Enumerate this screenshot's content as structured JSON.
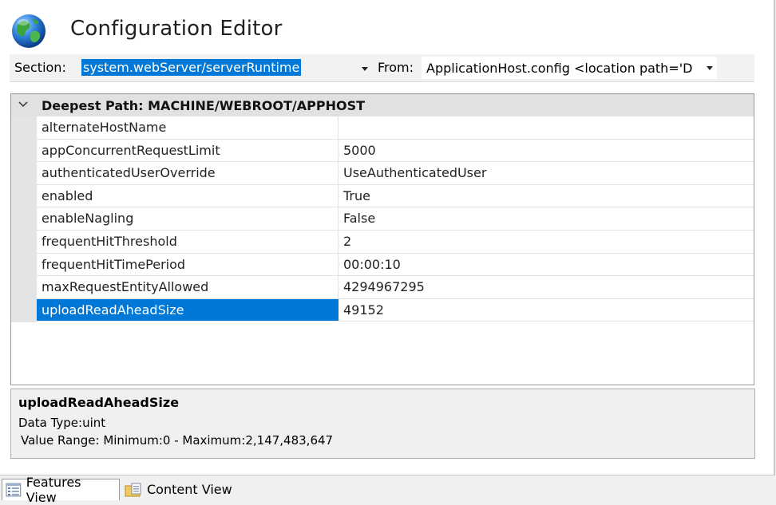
{
  "header": {
    "title": "Configuration Editor",
    "icon": "globe-icon"
  },
  "section_bar": {
    "section_label": "Section:",
    "section_value": "system.webServer/serverRuntime",
    "from_label": "From:",
    "from_value": "ApplicationHost.config <location path='D"
  },
  "grid": {
    "header": "Deepest Path: MACHINE/WEBROOT/APPHOST",
    "rows": [
      {
        "name": "alternateHostName",
        "value": ""
      },
      {
        "name": "appConcurrentRequestLimit",
        "value": "5000"
      },
      {
        "name": "authenticatedUserOverride",
        "value": "UseAuthenticatedUser"
      },
      {
        "name": "enabled",
        "value": "True"
      },
      {
        "name": "enableNagling",
        "value": "False"
      },
      {
        "name": "frequentHitThreshold",
        "value": "2"
      },
      {
        "name": "frequentHitTimePeriod",
        "value": "00:00:10"
      },
      {
        "name": "maxRequestEntityAllowed",
        "value": "4294967295"
      },
      {
        "name": "uploadReadAheadSize",
        "value": "49152"
      }
    ],
    "selected_row": "uploadReadAheadSize"
  },
  "details": {
    "title": "uploadReadAheadSize",
    "data_type": "Data Type:uint",
    "value_range": "Value Range: Minimum:0 - Maximum:2,147,483,647"
  },
  "tabs": [
    {
      "label": "Features View",
      "active": true,
      "icon": "features-view-icon"
    },
    {
      "label": "Content View",
      "active": false,
      "icon": "content-view-icon"
    }
  ],
  "colors": {
    "selection": "#0078d7",
    "grid_header": "#e1e1e1",
    "panel": "#f0f0f0"
  }
}
